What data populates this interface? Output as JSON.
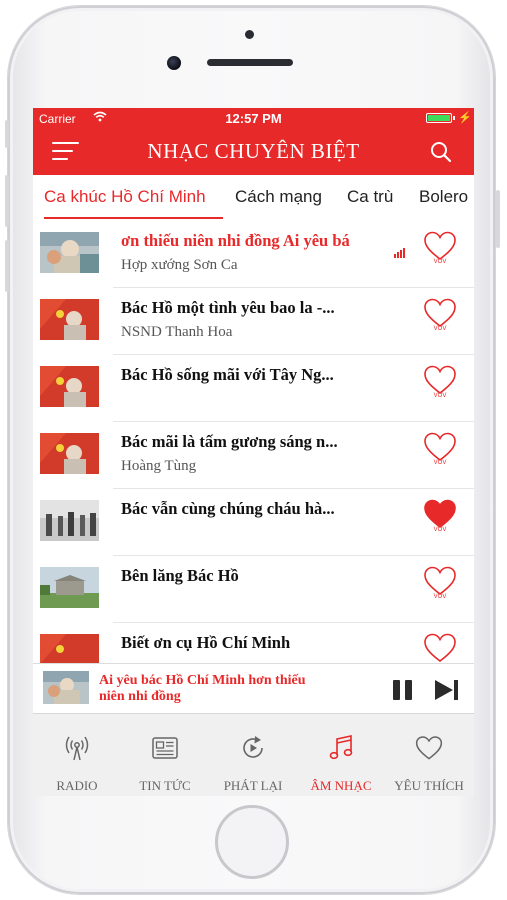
{
  "status_bar": {
    "carrier": "Carrier",
    "time": "12:57 PM"
  },
  "header": {
    "title": "NHẠC CHUYÊN BIỆT"
  },
  "tabs": [
    {
      "label": "Ca khúc Hồ Chí Minh",
      "active": true
    },
    {
      "label": "Cách mạng",
      "active": false
    },
    {
      "label": "Ca trù",
      "active": false
    },
    {
      "label": "Bolero",
      "active": false
    }
  ],
  "songs": [
    {
      "title": "ơn thiếu niên nhi đồng  Ai yêu bá",
      "artist": "Hợp xướng Sơn Ca",
      "playing": true,
      "favorite": false
    },
    {
      "title": "Bác Hồ một tình yêu bao la -...",
      "artist": "NSND Thanh Hoa",
      "playing": false,
      "favorite": false
    },
    {
      "title": "Bác Hồ sống mãi với Tây Ng...",
      "artist": "",
      "playing": false,
      "favorite": false
    },
    {
      "title": "Bác mãi là tấm gương sáng n...",
      "artist": "Hoàng Tùng",
      "playing": false,
      "favorite": false
    },
    {
      "title": "Bác vẫn cùng chúng cháu hà...",
      "artist": "",
      "playing": false,
      "favorite": true
    },
    {
      "title": "Bên lăng Bác Hồ",
      "artist": "",
      "playing": false,
      "favorite": false
    },
    {
      "title": "Biết ơn cụ Hồ Chí Minh",
      "artist": "",
      "playing": false,
      "favorite": false
    }
  ],
  "heart_caption": "VOV",
  "now_playing": {
    "title": "Ai yêu bác Hồ Chí Minh hơn thiếu niên nhi đồng"
  },
  "bottom_nav": [
    {
      "label": "RADIO",
      "icon": "radio-icon",
      "active": false
    },
    {
      "label": "TIN TỨC",
      "icon": "news-icon",
      "active": false
    },
    {
      "label": "PHÁT LẠI",
      "icon": "replay-icon",
      "active": false
    },
    {
      "label": "ÂM NHẠC",
      "icon": "music-note-icon",
      "active": true
    },
    {
      "label": "YÊU THÍCH",
      "icon": "heart-icon",
      "active": false
    }
  ],
  "colors": {
    "accent": "#e8292a",
    "tabbar_bg": "#f0f0f0",
    "text_dark": "#111111",
    "text_muted": "#555555"
  }
}
